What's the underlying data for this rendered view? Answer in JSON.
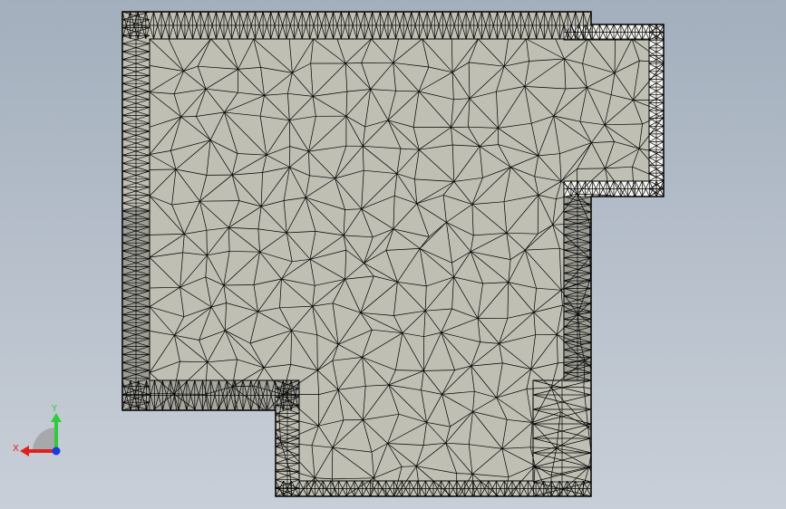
{
  "viewport": {
    "background_top": "#a3afbd",
    "background_bottom": "#c9cfd8"
  },
  "mesh": {
    "fill_color": "#bfbfb4",
    "edge_color": "#000000",
    "shade_light": "#f4f4f0",
    "shade_dark": "#8d8d86",
    "element_type": "triangular"
  },
  "triad": {
    "x_label": "X",
    "y_label": "Y",
    "x_color": "#e0201c",
    "y_color": "#2ecc3a",
    "z_color": "#1c3ce0"
  }
}
